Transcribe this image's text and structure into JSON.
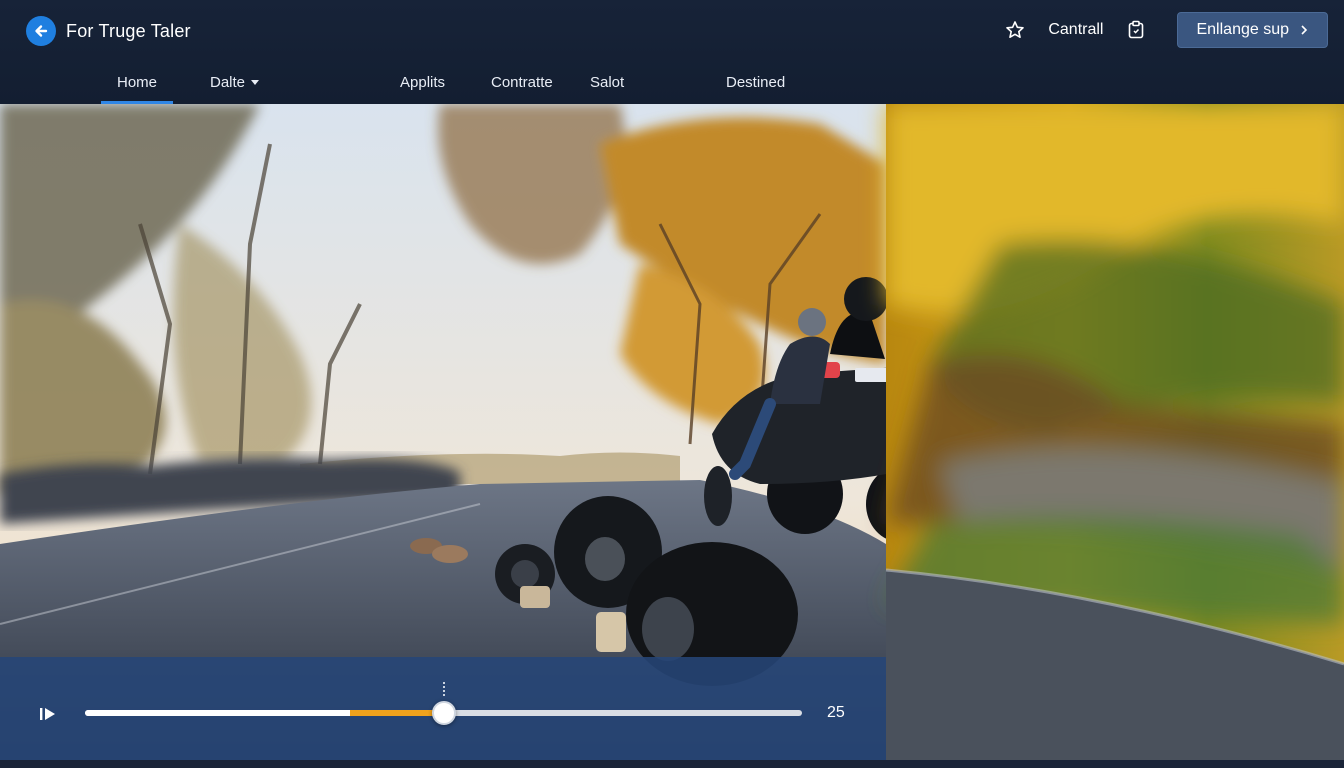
{
  "header": {
    "title": "For Truge Taler",
    "back_icon": "back-arrow-icon",
    "accent_color": "#1f7fe0"
  },
  "actions": {
    "favorite_icon": "star-icon",
    "account_label": "Cantrall",
    "clipboard_icon": "clipboard-icon",
    "cta_label": "Enllange sup",
    "cta_icon": "chevron-right-icon"
  },
  "nav": {
    "items": [
      {
        "label": "Home",
        "active": true
      },
      {
        "label": "Dalte",
        "dropdown": true
      },
      {
        "label": "Applits"
      },
      {
        "label": "Contratte"
      },
      {
        "label": "Salot"
      },
      {
        "label": "Destined"
      }
    ]
  },
  "player": {
    "play_icon": "play-pause-icon",
    "progress": 0.5,
    "buffered": 0.37,
    "time_label": "25",
    "played_color": "#f0a21c"
  }
}
